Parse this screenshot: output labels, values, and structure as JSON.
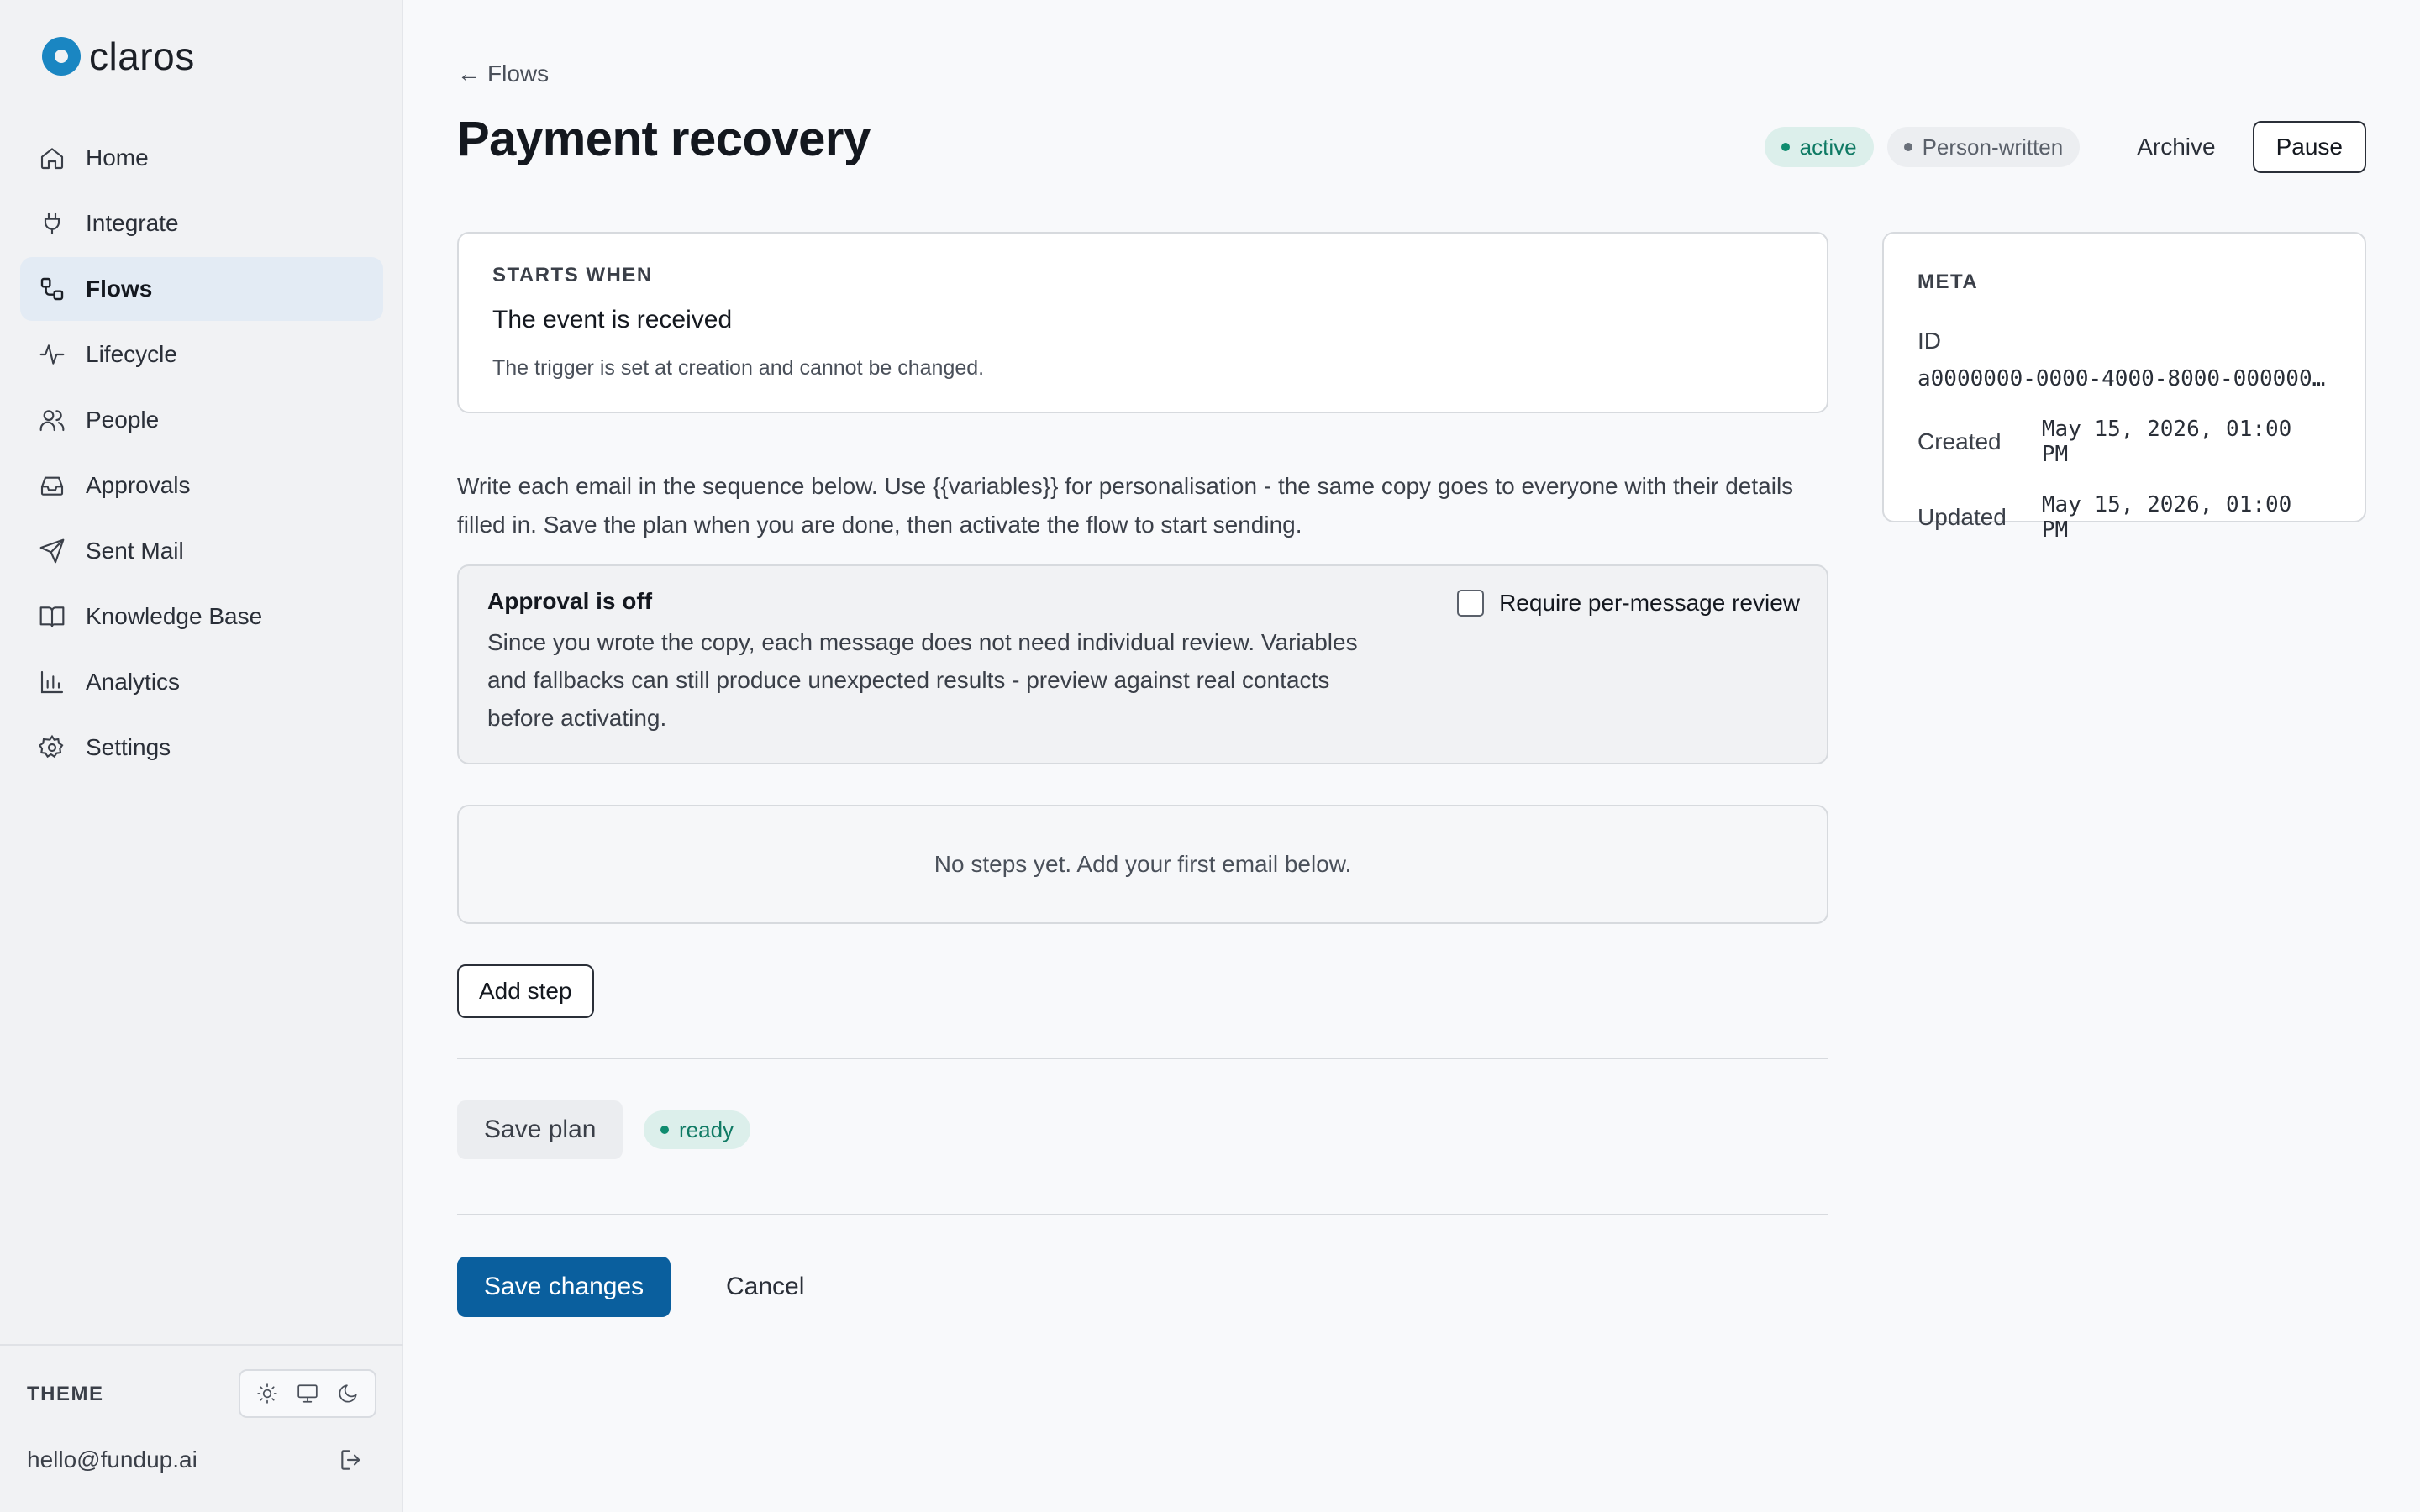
{
  "app": {
    "brand": "claros",
    "accent": "#1a86c2",
    "primary": "#0a5f9e"
  },
  "sidebar": {
    "items": [
      {
        "label": "Home",
        "icon": "home-icon"
      },
      {
        "label": "Integrate",
        "icon": "plug-icon"
      },
      {
        "label": "Flows",
        "icon": "flows-icon",
        "active": true
      },
      {
        "label": "Lifecycle",
        "icon": "activity-icon"
      },
      {
        "label": "People",
        "icon": "users-icon"
      },
      {
        "label": "Approvals",
        "icon": "inbox-icon"
      },
      {
        "label": "Sent Mail",
        "icon": "send-icon"
      },
      {
        "label": "Knowledge Base",
        "icon": "book-icon"
      },
      {
        "label": "Analytics",
        "icon": "bar-chart-icon"
      },
      {
        "label": "Settings",
        "icon": "gear-icon"
      }
    ],
    "theme_label": "THEME",
    "user_email": "hello@fundup.ai"
  },
  "header": {
    "back_label": "Flows",
    "title": "Payment recovery",
    "status_badge": "active",
    "author_badge": "Person-written",
    "archive_label": "Archive",
    "pause_label": "Pause"
  },
  "trigger": {
    "eyebrow": "STARTS WHEN",
    "title": "The event is received",
    "note": "The trigger is set at creation and cannot be changed."
  },
  "meta": {
    "eyebrow": "META",
    "id_label": "ID",
    "id_value": "a0000000-0000-4000-8000-000000…",
    "created_label": "Created",
    "created_value": "May 15, 2026, 01:00 PM",
    "updated_label": "Updated",
    "updated_value": "May 15, 2026, 01:00 PM"
  },
  "intro": "Write each email in the sequence below. Use {{variables}} for personalisation - the same copy goes to everyone with their details filled in. Save the plan when you are done, then activate the flow to start sending.",
  "approval": {
    "title": "Approval is off",
    "body": "Since you wrote the copy, each message does not need individual review. Variables and fallbacks can still produce unexpected results - preview against real contacts before activating.",
    "checkbox_label": "Require per-message review"
  },
  "steps": {
    "empty_text": "No steps yet. Add your first email below."
  },
  "actions": {
    "add_step": "Add step",
    "save_plan": "Save plan",
    "plan_status": "ready",
    "save_changes": "Save changes",
    "cancel": "Cancel"
  }
}
